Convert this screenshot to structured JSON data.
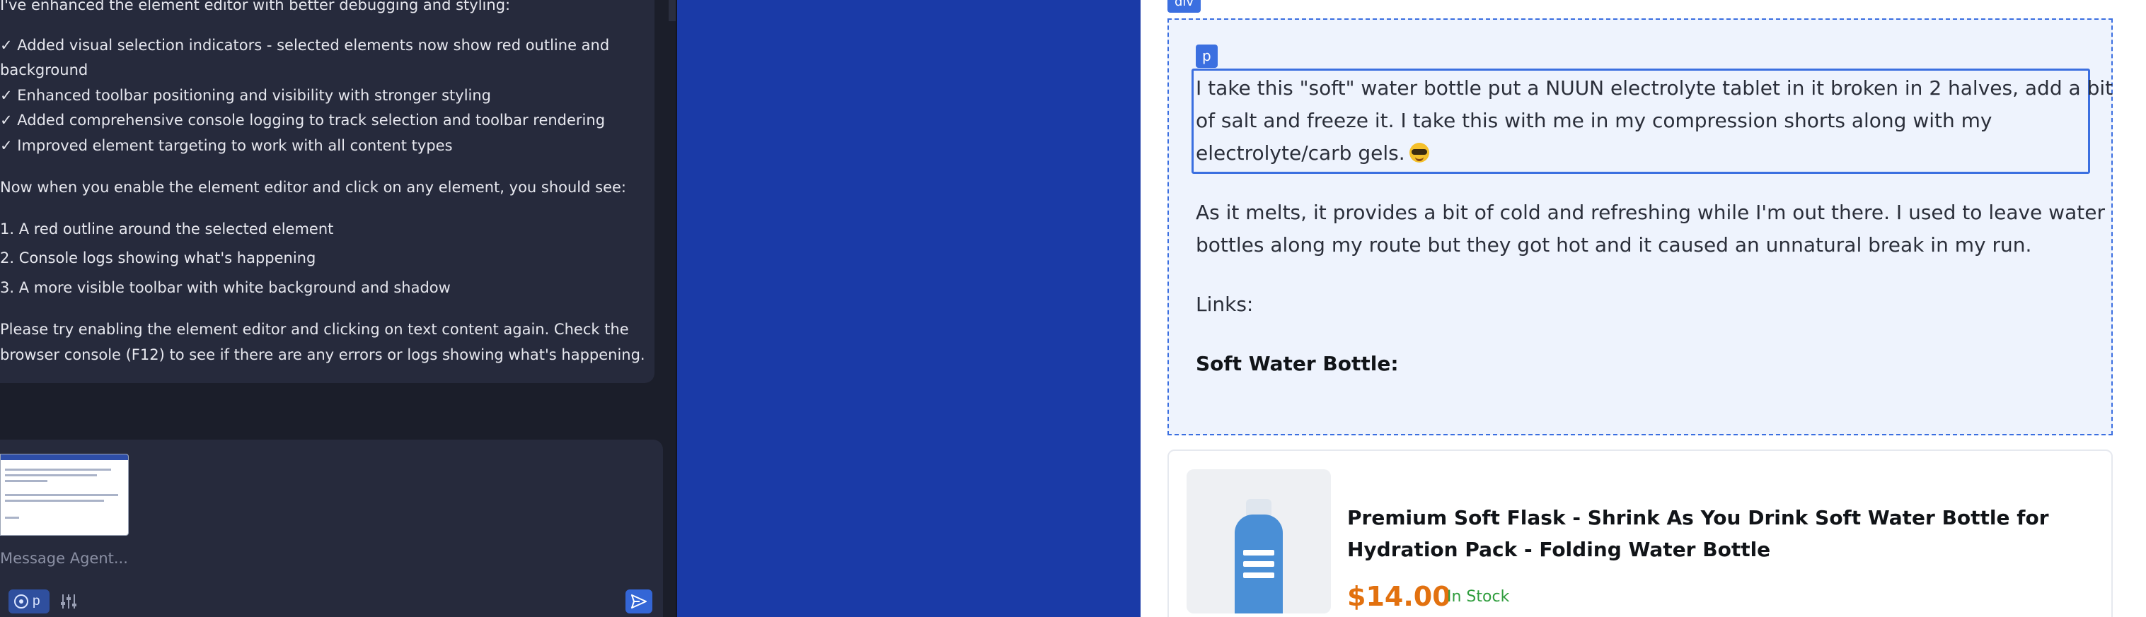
{
  "chat": {
    "message_lines": [
      "I've enhanced the element editor with better debugging and styling:",
      "✓ Added visual selection indicators - selected elements now show red outline and",
      "background",
      "✓ Enhanced toolbar positioning and visibility with stronger styling",
      "✓ Added comprehensive console logging to track selection and toolbar rendering",
      "✓ Improved element targeting to work with all content types",
      "Now when you enable the element editor and click on any element, you should see:",
      "1. A red outline around the selected element",
      "2. Console logs showing what's happening",
      "3. A more visible toolbar with white background and shadow",
      "Please try enabling the element editor and clicking on text content again. Check the",
      "browser console (F12) to see if there are any errors or logs showing what's happening."
    ],
    "input_placeholder": "Message Agent...",
    "mode_chip_label": "p",
    "icons": {
      "target": "target-icon",
      "sliders": "sliders-icon",
      "send": "send-icon"
    }
  },
  "preview": {
    "div_tag": "div",
    "p_tag": "p",
    "paragraph1_lines": [
      "I take this \"soft\" water bottle put a NUUN electrolyte tablet in it broken in 2 halves, add a bit",
      "of salt and freeze it. I take this with me in my compression shorts along with my",
      "electrolyte/carb gels."
    ],
    "paragraph2_lines": [
      "As it melts, it provides a bit of cold and refreshing while I'm out there. I used to leave water",
      "bottles along my route but they got hot and it caused an unnatural break in my run."
    ],
    "links_label": "Links:",
    "soft_bottle_heading": "Soft Water Bottle:",
    "product": {
      "title": "Premium Soft Flask - Shrink As You Drink Soft Water Bottle for Hydration Pack - Folding Water Bottle",
      "price": "$14.00",
      "stock": "In Stock"
    },
    "colors": {
      "selection": "#3b6fe0",
      "price": "#e2710f",
      "stock": "#2f9d3d",
      "canvas": "#1a3aa7"
    }
  }
}
